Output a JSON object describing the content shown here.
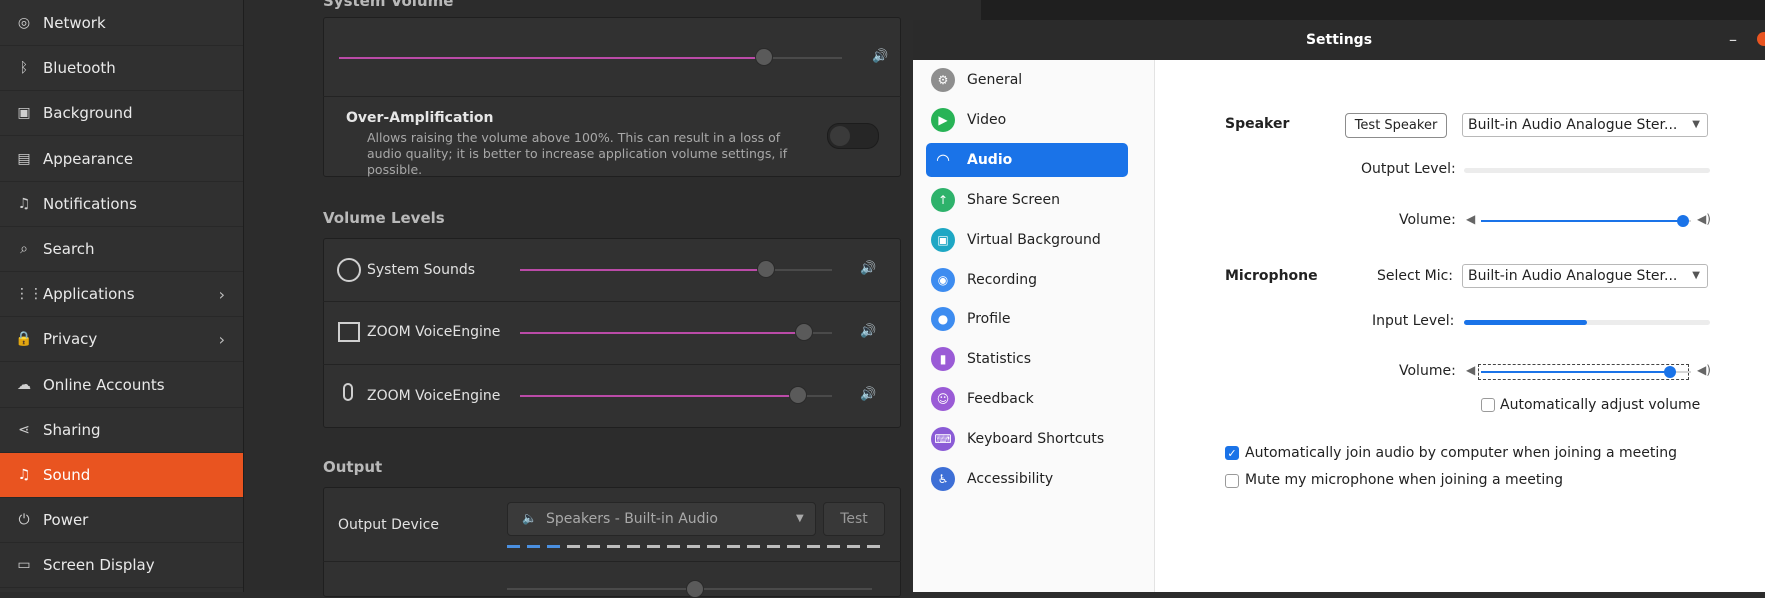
{
  "sidebar": {
    "items": [
      {
        "label": "Network",
        "icon": "network-icon",
        "glyph": "◎"
      },
      {
        "label": "Bluetooth",
        "icon": "bluetooth-icon",
        "glyph": "ᛒ"
      },
      {
        "label": "Background",
        "icon": "background-icon",
        "glyph": "▣"
      },
      {
        "label": "Appearance",
        "icon": "appearance-icon",
        "glyph": "▤"
      },
      {
        "label": "Notifications",
        "icon": "bell-icon",
        "glyph": "♫"
      },
      {
        "label": "Search",
        "icon": "search-icon",
        "glyph": "⌕"
      },
      {
        "label": "Applications",
        "icon": "apps-grid-icon",
        "glyph": "⋮⋮"
      },
      {
        "label": "Privacy",
        "icon": "lock-icon",
        "glyph": "🔒"
      },
      {
        "label": "Online Accounts",
        "icon": "cloud-icon",
        "glyph": "☁"
      },
      {
        "label": "Sharing",
        "icon": "share-icon",
        "glyph": "⋖"
      },
      {
        "label": "Sound",
        "icon": "music-note-icon",
        "glyph": "♫"
      },
      {
        "label": "Power",
        "icon": "power-icon",
        "glyph": "⏻"
      },
      {
        "label": "Screen Display",
        "icon": "display-icon",
        "glyph": "▭"
      }
    ],
    "active": "Sound"
  },
  "sound": {
    "system_volume_header": "System Volume",
    "over_amp_title": "Over-Amplification",
    "over_amp_desc": "Allows raising the volume above 100%. This can result in a loss of audio quality; it is better to increase application volume settings, if possible.",
    "volume_levels_header": "Volume Levels",
    "apps": [
      {
        "label": "System Sounds",
        "icon": "gear-sound-icon",
        "level": 0.79
      },
      {
        "label": "ZOOM VoiceEngine",
        "icon": "film-icon",
        "level": 0.91
      },
      {
        "label": "ZOOM VoiceEngine",
        "icon": "microphone-icon",
        "level": 0.89
      }
    ],
    "output_header": "Output",
    "output_device_label": "Output Device",
    "output_device_value": "Speakers - Built-in Audio",
    "test_label": "Test"
  },
  "zoom": {
    "title": "Settings",
    "nav": [
      {
        "label": "General",
        "icon": "gear-icon",
        "color": "#8e8e8e",
        "glyph": "⚙"
      },
      {
        "label": "Video",
        "icon": "video-icon",
        "color": "#28b356",
        "glyph": "▶"
      },
      {
        "label": "Audio",
        "icon": "headphones-icon",
        "color": "#1a73e8",
        "glyph": "◠"
      },
      {
        "label": "Share Screen",
        "icon": "share-screen-icon",
        "color": "#2eb26b",
        "glyph": "↑"
      },
      {
        "label": "Virtual Background",
        "icon": "virtual-background-icon",
        "color": "#1ea7c4",
        "glyph": "▣"
      },
      {
        "label": "Recording",
        "icon": "record-icon",
        "color": "#3d8cf0",
        "glyph": "◉"
      },
      {
        "label": "Profile",
        "icon": "profile-icon",
        "color": "#3d8cf0",
        "glyph": "●"
      },
      {
        "label": "Statistics",
        "icon": "statistics-icon",
        "color": "#9a5bd6",
        "glyph": "▮"
      },
      {
        "label": "Feedback",
        "icon": "feedback-icon",
        "color": "#9a5bd6",
        "glyph": "☺"
      },
      {
        "label": "Keyboard Shortcuts",
        "icon": "keyboard-icon",
        "color": "#8a5bd6",
        "glyph": "⌨"
      },
      {
        "label": "Accessibility",
        "icon": "accessibility-icon",
        "color": "#3d6fd6",
        "glyph": "♿"
      }
    ],
    "active_nav": "Audio",
    "speaker_label": "Speaker",
    "test_speaker": "Test Speaker",
    "speaker_device": "Built-in Audio Analogue Ster...",
    "output_level_label": "Output Level:",
    "volume_label": "Volume:",
    "speaker_volume": 0.96,
    "microphone_label": "Microphone",
    "select_mic_label": "Select Mic:",
    "mic_device": "Built-in Audio Analogue Ster...",
    "input_level_label": "Input Level:",
    "input_level": 0.5,
    "mic_volume": 0.9,
    "auto_adjust_label": "Automatically adjust volume",
    "auto_adjust_checked": false,
    "auto_join_label": "Automatically join audio by computer when joining a meeting",
    "auto_join_checked": true,
    "mute_mic_label": "Mute my microphone when joining a meeting",
    "mute_mic_checked": false
  }
}
